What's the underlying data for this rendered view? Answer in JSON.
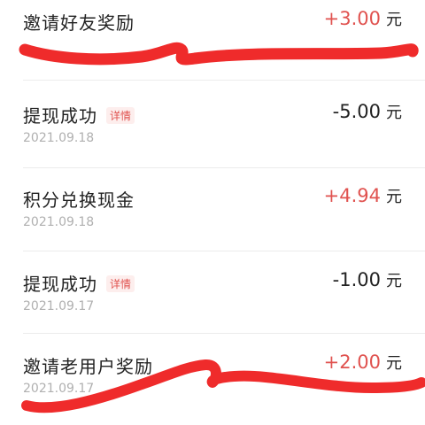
{
  "currency_unit": "元",
  "colors": {
    "positive": "#e0524f",
    "negative": "#222222",
    "scribble": "#ef2b2b"
  },
  "transactions": [
    {
      "title": "邀请好友奖励",
      "tag": "",
      "date": "",
      "amount": "+3.00",
      "sign": "positive"
    },
    {
      "title": "提现成功",
      "tag": "详情",
      "date": "2021.09.18",
      "amount": "-5.00",
      "sign": "negative"
    },
    {
      "title": "积分兑换现金",
      "tag": "",
      "date": "2021.09.18",
      "amount": "+4.94",
      "sign": "positive"
    },
    {
      "title": "提现成功",
      "tag": "详情",
      "date": "2021.09.17",
      "amount": "-1.00",
      "sign": "negative"
    },
    {
      "title": "邀请老用户奖励",
      "tag": "",
      "date": "2021.09.17",
      "amount": "+2.00",
      "sign": "positive"
    }
  ]
}
